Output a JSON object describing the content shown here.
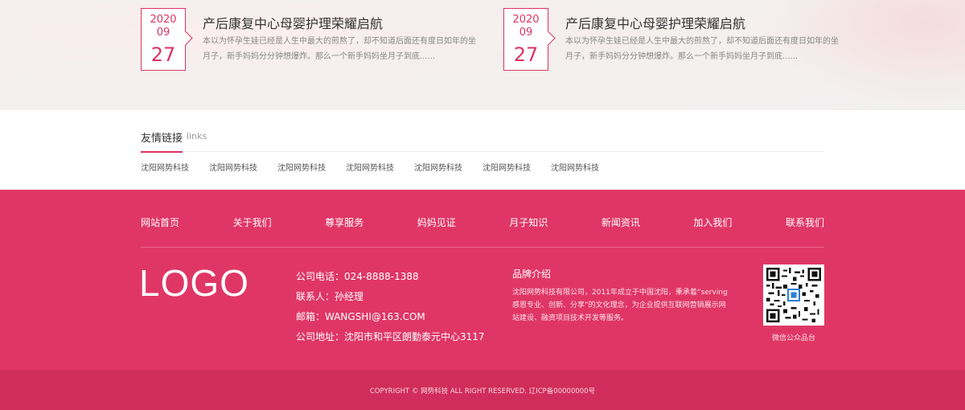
{
  "news": [
    {
      "year": "2020",
      "month": "09",
      "day": "27",
      "title": "产后康复中心母婴护理荣耀启航",
      "desc": "本以为怀孕生娃已经是人生中最大的煎熬了，却不知道后面还有度日如年的坐月子，新手妈妈分分钟想爆炸。那么一个新手妈妈坐月子到底......"
    },
    {
      "year": "2020",
      "month": "09",
      "day": "27",
      "title": "产后康复中心母婴护理荣耀启航",
      "desc": "本以为怀孕生娃已经是人生中最大的煎熬了，却不知道后面还有度日如年的坐月子，新手妈妈分分钟想爆炸。那么一个新手妈妈坐月子到底......"
    }
  ],
  "links": {
    "title": "友情链接",
    "subtitle": "links",
    "items": [
      "沈阳网势科技",
      "沈阳网势科技",
      "沈阳网势科技",
      "沈阳网势科技",
      "沈阳网势科技",
      "沈阳网势科技",
      "沈阳网势科技"
    ]
  },
  "footer": {
    "nav": [
      "网站首页",
      "关于我们",
      "尊享服务",
      "妈妈见证",
      "月子知识",
      "新闻资讯",
      "加入我们",
      "联系我们"
    ],
    "logo": "LOGO",
    "contact": {
      "phone": "公司电话：024-8888-1388",
      "person": "联系人：孙经理",
      "email": "邮箱：WANGSHI@163.COM",
      "address": "公司地址：沈阳市和平区朗勤泰元中心3117"
    },
    "brand": {
      "title": "品牌介绍",
      "text": "沈阳网势科技有限公司，2011年成立于中国沈阳，秉承着“serving感恩专业、创新、分享”的文化理念，为企业提供互联网营销展示网站建设、融资项目技术开发等服务。"
    },
    "qr_label": "微信公众品台",
    "copyright": "COPYRIGHT © 网势科技 ALL RIGHT RESERVED.    辽ICP备00000000号"
  },
  "colors": {
    "accent": "#e03666",
    "accent_dark": "#d12d5b"
  }
}
